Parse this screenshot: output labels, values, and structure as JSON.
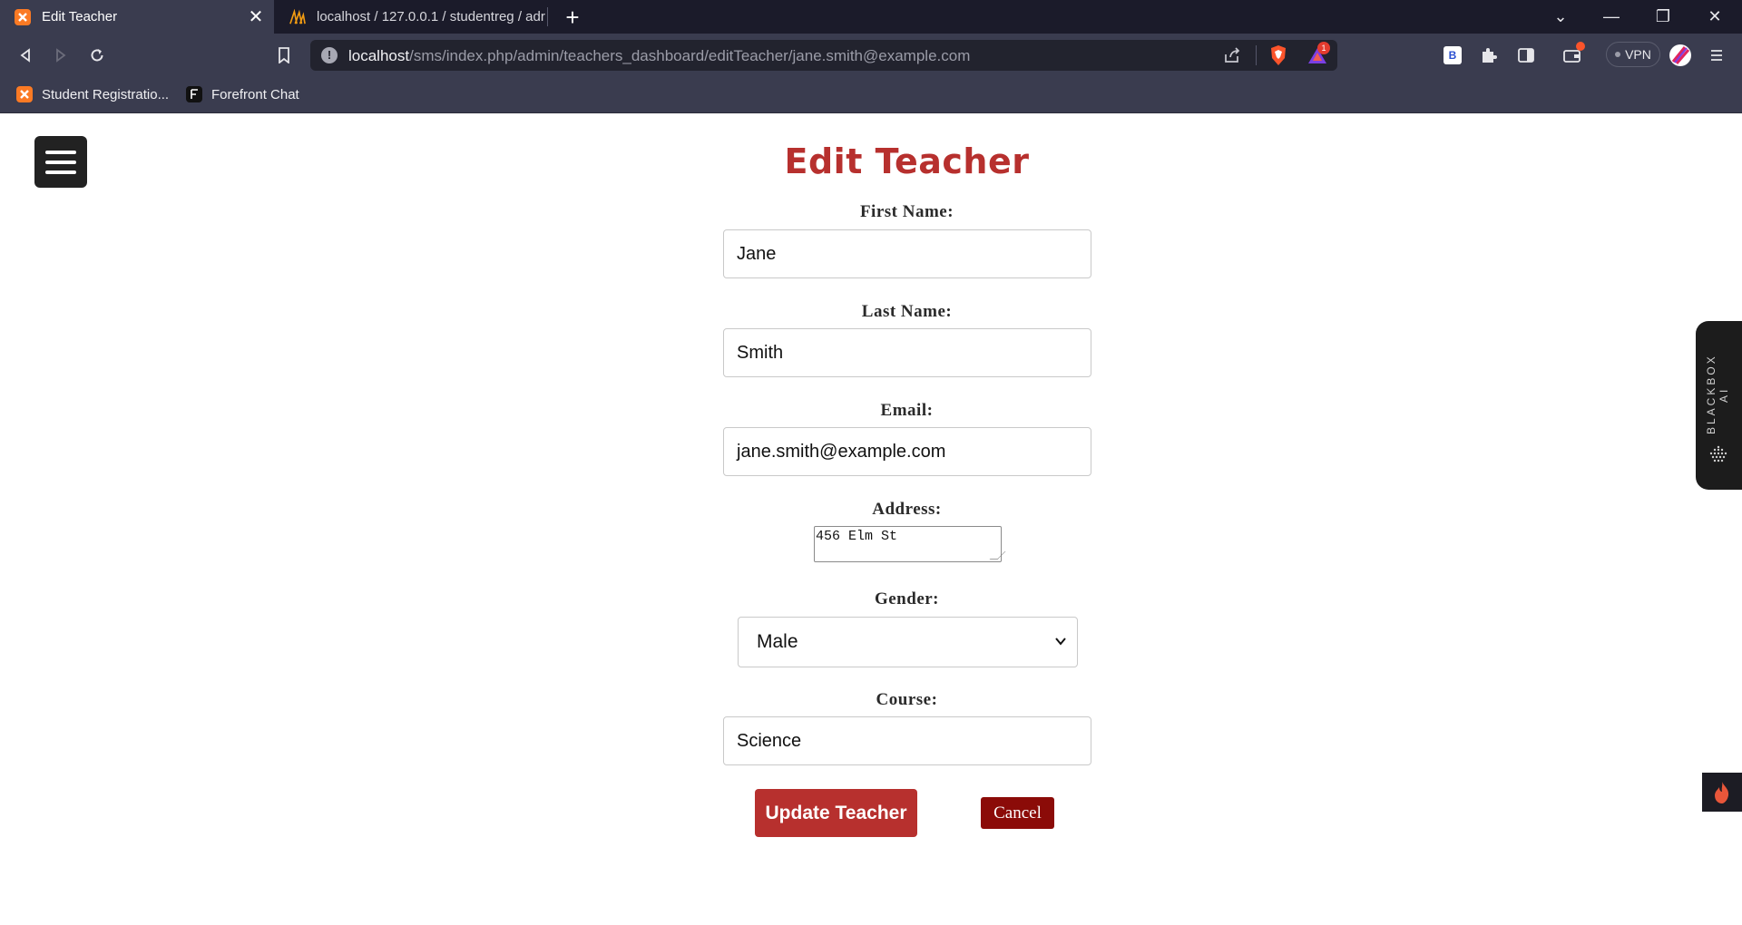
{
  "browser": {
    "tabs": [
      {
        "title": "Edit Teacher",
        "active": true,
        "icon": "xampp-icon"
      },
      {
        "title": "localhost / 127.0.0.1 / studentreg / adr",
        "active": false,
        "icon": "phpmyadmin-icon"
      }
    ],
    "url": {
      "host": "localhost",
      "path": "/sms/index.php/admin/teachers_dashboard/editTeacher/jane.smith@example.com"
    },
    "vpn_label": "VPN",
    "notification_count": "1",
    "bookmarks": [
      {
        "label": "Student Registratio...",
        "icon": "xampp-icon"
      },
      {
        "label": "Forefront Chat",
        "icon": "forefront-icon"
      }
    ]
  },
  "page": {
    "heading": "Edit Teacher",
    "form": {
      "first_name": {
        "label": "First Name:",
        "value": "Jane"
      },
      "last_name": {
        "label": "Last Name:",
        "value": "Smith"
      },
      "email": {
        "label": "Email:",
        "value": "jane.smith@example.com"
      },
      "address": {
        "label": "Address:",
        "value": "456 Elm St"
      },
      "gender": {
        "label": "Gender:",
        "value": "Male"
      },
      "course": {
        "label": "Course:",
        "value": "Science"
      }
    },
    "update_button": "Update Teacher",
    "cancel_button": "Cancel"
  },
  "sidebar_widget": {
    "label": "BLACKBOX AI"
  },
  "colors": {
    "accent": "#b7302e",
    "cancel": "#8b0b08",
    "chrome_dark": "#1b1b2a",
    "chrome": "#3a3c4f"
  }
}
